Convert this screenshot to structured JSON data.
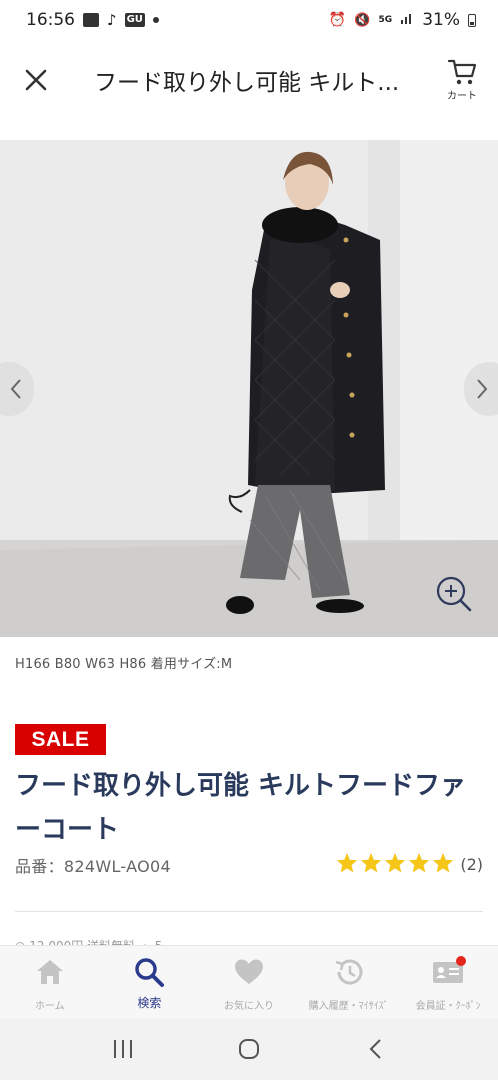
{
  "status_bar": {
    "time": "16:56",
    "network": "5G",
    "battery": "31%"
  },
  "header": {
    "title": "フード取り外し可能 キルト...",
    "cart_label": "カート"
  },
  "gallery": {
    "model_info": "H166 B80 W63 H86 着用サイズ:M"
  },
  "product": {
    "sale_badge": "SALE",
    "title": "フード取り外し可能 キルトフードファーコート",
    "code": "品番：824WL-AO04",
    "rating": 5,
    "review_count": "(2)",
    "peek_text": "◎ 12,000円 送料無料 ・ 5..."
  },
  "bottom_nav": {
    "items": [
      {
        "label": "ホーム",
        "icon": "home-icon",
        "active": false
      },
      {
        "label": "検索",
        "icon": "search-icon",
        "active": true
      },
      {
        "label": "お気に入り",
        "icon": "heart-icon",
        "active": false
      },
      {
        "label": "購入履歴・ﾏｲｻｲｽﾞ",
        "icon": "history-icon",
        "active": false
      },
      {
        "label": "会員証・ｸｰﾎﾟﾝ",
        "icon": "member-card-icon",
        "active": false
      }
    ]
  },
  "colors": {
    "sale_red": "#d90000",
    "title_navy": "#2a3a5c",
    "star_yellow": "#f5c518",
    "active_nav": "#2a3a8c",
    "notification_red": "#e5261c"
  }
}
